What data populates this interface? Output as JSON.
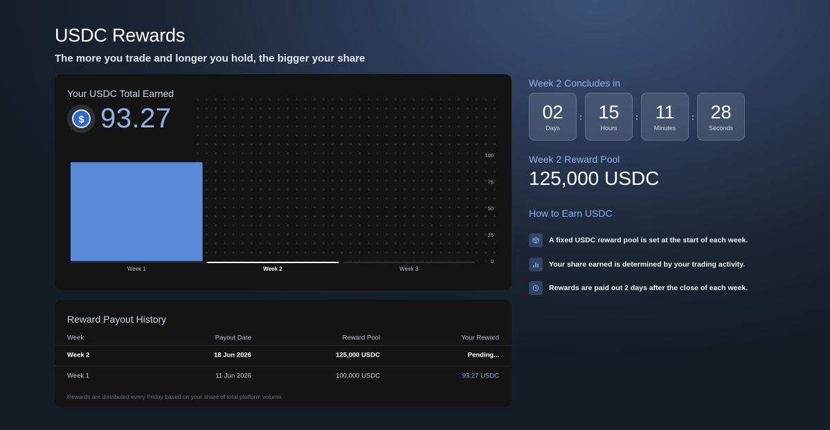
{
  "header": {
    "title": "USDC Rewards",
    "subtitle": "The more you trade and longer you hold, the bigger your share"
  },
  "earned": {
    "label": "Your USDC Total Earned",
    "value": "93.27",
    "icon": "usdc-coin-icon"
  },
  "chart_data": {
    "type": "bar",
    "categories": [
      "Week 1",
      "Week 2",
      "Week 3"
    ],
    "values": [
      93.27,
      0,
      0
    ],
    "ylim": [
      0,
      100
    ],
    "yticks": [
      "0",
      "25",
      "50",
      "75",
      "100"
    ],
    "highlighted_category": "Week 2",
    "colors": {
      "bar": "#5b8bd6",
      "active_baseline": "#ffffff",
      "baseline": "#3a3a3a"
    },
    "grid": "dotted background"
  },
  "countdown": {
    "label": "Week 2 Concludes in",
    "units": [
      {
        "value": "02",
        "unit": "Days"
      },
      {
        "value": "15",
        "unit": "Hours"
      },
      {
        "value": "11",
        "unit": "Minutes"
      },
      {
        "value": "28",
        "unit": "Seconds"
      }
    ],
    "separator": ":"
  },
  "pool": {
    "label": "Week 2 Reward Pool",
    "value": "125,000 USDC"
  },
  "how_to_earn": {
    "label": "How to Earn USDC",
    "items": [
      {
        "icon": "cube-icon",
        "text": "A fixed USDC reward pool is set at the start of each week."
      },
      {
        "icon": "bar-chart-icon",
        "text": "Your share earned is determined by your trading activity."
      },
      {
        "icon": "clock-icon",
        "text": "Rewards are paid out 2 days after the close of each week."
      }
    ]
  },
  "history": {
    "title": "Reward Payout History",
    "columns": [
      "Week",
      "Payout Date",
      "Reward Pool",
      "Your Reward"
    ],
    "rows": [
      {
        "week": "Week 2",
        "date": "18 Jun 2026",
        "pool": "125,000 USDC",
        "reward": "Pending..."
      },
      {
        "week": "Week 1",
        "date": "11 Jun 2026",
        "pool": "100,000 USDC",
        "reward": "93.27 USDC"
      }
    ],
    "note": "Rewards are distributed every Friday based on your share of total platform volume."
  },
  "colors": {
    "accent": "#8fb2e8",
    "card_bg": "#141414",
    "reward_link": "#7ea4e6"
  }
}
